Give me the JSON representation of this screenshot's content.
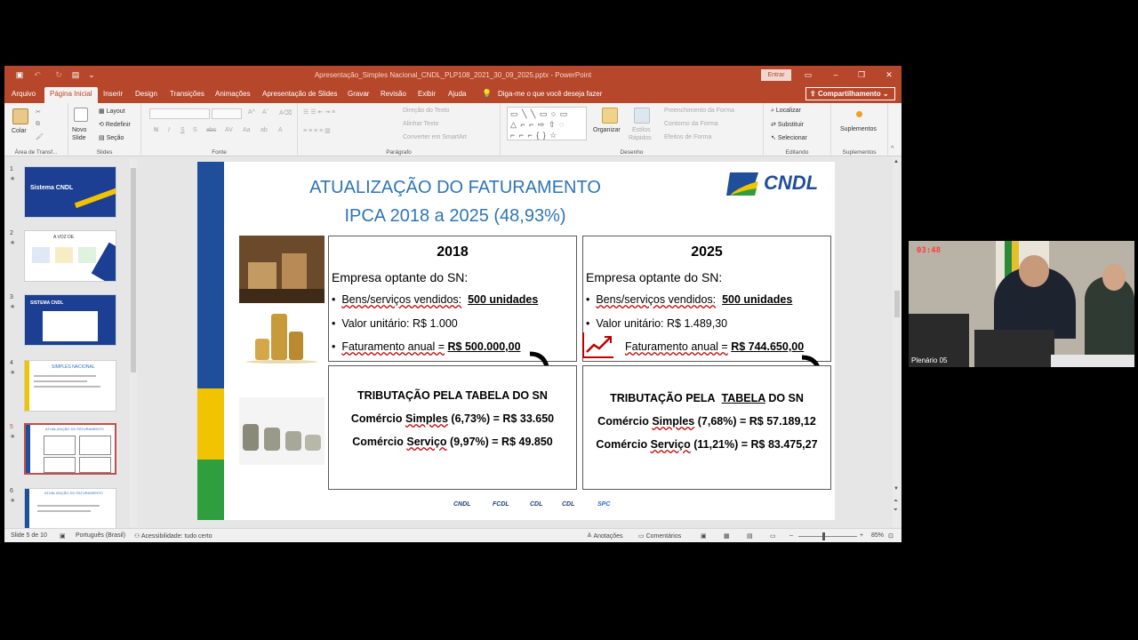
{
  "window": {
    "title": "Apresentação_Simples Nacional_CNDL_PLP108_2021_30_09_2025.pptx  -  PowerPoint",
    "signin": "Entrar"
  },
  "menu": {
    "tabs": [
      "Arquivo",
      "Página Inicial",
      "Inserir",
      "Design",
      "Transições",
      "Animações",
      "Apresentação de Slides",
      "Gravar",
      "Revisão",
      "Exibir",
      "Ajuda"
    ],
    "active_tab": "Página Inicial",
    "tellme": "Diga-me o que você deseja fazer",
    "share": "Compartilhamento"
  },
  "ribbon": {
    "clipboard": {
      "paste": "Colar",
      "label": "Área de Transf..."
    },
    "slides": {
      "new": "Novo",
      "new2": "Slide",
      "layout": "Layout",
      "reset": "Redefinir",
      "section": "Seção",
      "label": "Slides"
    },
    "font": {
      "label": "Fonte"
    },
    "paragraph": {
      "text_dir": "Direção do Texto",
      "align_text": "Alinhar Texto",
      "smartart": "Converter em SmartArt",
      "label": "Parágrafo"
    },
    "drawing": {
      "arrange": "Organizar",
      "styles": "Estilos",
      "styles2": "Rápidos",
      "fill": "Preenchimento da Forma",
      "outline": "Contorno da Forma",
      "effects": "Efeitos de Forma",
      "label": "Desenho"
    },
    "editing": {
      "find": "Localizar",
      "replace": "Substituir",
      "select": "Selecionar",
      "label": "Editando"
    },
    "addins": {
      "addins": "Suplementos",
      "label": "Suplementos"
    }
  },
  "thumbnails": [
    {
      "num": "1",
      "title": "Sistema CNDL"
    },
    {
      "num": "2",
      "title": "A VOZ DE"
    },
    {
      "num": "3",
      "title": "SISTEMA CNDL"
    },
    {
      "num": "4",
      "title": "SIMPLES NACIONAL"
    },
    {
      "num": "5",
      "title": "ATUALIZAÇÃO DO FATURAMENTO"
    },
    {
      "num": "6",
      "title": "ATUALIZAÇÃO DO FATURAMENTO"
    }
  ],
  "slide": {
    "title_line1": "ATUALIZAÇÃO DO FATURAMENTO",
    "title_line2": "IPCA 2018 a 2025 (48,93%)",
    "logo": "CNDL",
    "left": {
      "year": "2018",
      "company": "Empresa optante do SN:",
      "goods_label": "Bens/serviços vendidos:",
      "goods_value": "500 unidades",
      "unit_label": "Valor unitário: R$ 1.000",
      "revenue_label": "Faturamento anual =",
      "revenue_value": "R$ 500.000,00",
      "tax_title": "TRIBUTAÇÃO PELA TABELA DO SN",
      "tax_commerce_pre": "Comércio",
      "tax_commerce_word": "Simples",
      "tax_commerce_post": "(6,73%) = R$ 33.650",
      "tax_service_pre": "Comércio",
      "tax_service_word": "Serviço",
      "tax_service_post": "(9,97%) = R$ 49.850"
    },
    "right": {
      "year": "2025",
      "company": "Empresa optante do SN:",
      "goods_label": "Bens/serviços vendidos:",
      "goods_value": "500 unidades",
      "unit_label": "Valor unitário: R$ 1.489,30",
      "revenue_label": "Faturamento anual =",
      "revenue_value": "R$ 744.650,00",
      "tax_title_pre": "TRIBUTAÇÃO PELA",
      "tax_title_word": "TABELA",
      "tax_title_post": "DO SN",
      "tax_commerce_pre": "Comércio",
      "tax_commerce_word": "Simples",
      "tax_commerce_post": "(7,68%) = R$ 57.189,12",
      "tax_service_pre": "Comércio",
      "tax_service_word": "Serviço",
      "tax_service_post": "(11,21%) = R$ 83.475,27"
    },
    "footer_logos": [
      "CNDL",
      "FCDL",
      "CDL",
      "CDL",
      "SPC"
    ]
  },
  "status": {
    "slide": "Slide 5 de 10",
    "language": "Português (Brasil)",
    "accessibility": "Acessibilidade: tudo certo",
    "notes": "Anotações",
    "comments": "Comentários",
    "zoom": "85%"
  },
  "video": {
    "time": "03:48",
    "label": "Plenário 05"
  },
  "colors": {
    "ppt_accent": "#b7472a",
    "title_blue": "#2e75b6",
    "bar_blue": "#1f4e9a",
    "bar_yellow": "#f2c300",
    "bar_green": "#2e9e3e"
  }
}
